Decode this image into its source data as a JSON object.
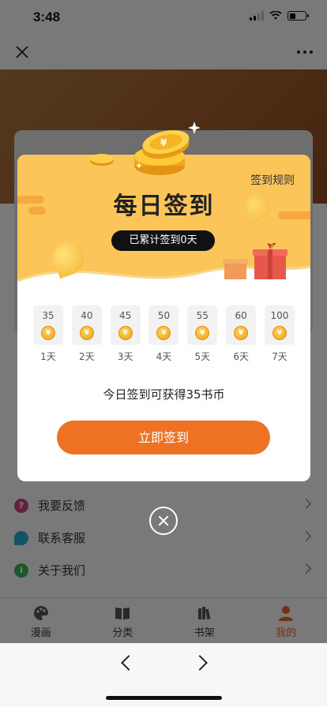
{
  "status": {
    "time": "3:48"
  },
  "menu": [
    {
      "label": "我要反馈",
      "icon": "feedback-icon",
      "color": "#c9407a"
    },
    {
      "label": "联系客服",
      "icon": "chat-icon",
      "color": "#2aa7c9"
    },
    {
      "label": "关于我们",
      "icon": "info-icon",
      "color": "#3fae5a"
    }
  ],
  "tabs": [
    {
      "label": "漫画",
      "icon": "palette-icon"
    },
    {
      "label": "分类",
      "icon": "book-icon"
    },
    {
      "label": "书架",
      "icon": "bookshelf-icon"
    },
    {
      "label": "我的",
      "icon": "user-icon",
      "active": true
    }
  ],
  "dialog": {
    "rules_label": "签到规则",
    "title": "每日签到",
    "accumulated": "已累计签到0天",
    "days": [
      {
        "amount": "35",
        "label": "1天"
      },
      {
        "amount": "40",
        "label": "2天"
      },
      {
        "amount": "45",
        "label": "3天"
      },
      {
        "amount": "50",
        "label": "4天"
      },
      {
        "amount": "55",
        "label": "5天"
      },
      {
        "amount": "60",
        "label": "6天"
      },
      {
        "amount": "100",
        "label": "7天"
      }
    ],
    "coin_glyph": "¥",
    "reward_text": "今日签到可获得35书币",
    "button_label": "立即签到"
  },
  "colors": {
    "accent": "#ee7223",
    "header": "#fbc55a"
  }
}
